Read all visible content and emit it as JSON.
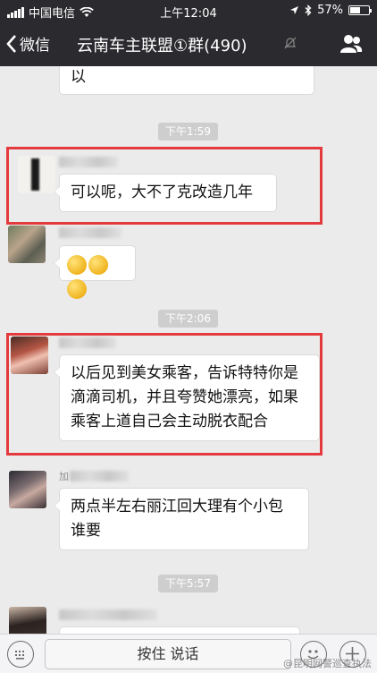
{
  "status_bar": {
    "carrier": "中国电信",
    "time": "上午12:04",
    "battery": "57%",
    "battery_level": 0.57
  },
  "nav": {
    "back_label": "微信",
    "title": "云南车主联盟①群(490)"
  },
  "messages": {
    "top_fragment": "以",
    "time_1": "下午1:59",
    "msg_1": "可以呢，大不了克改造几年",
    "time_2": "下午2:06",
    "msg_3": "以后见到美女乘客，告诉特特你是滴滴司机，并且夸赞她漂亮，如果乘客上道自己会主动脱衣配合",
    "name_4_visible": "加",
    "msg_4": "两点半左右丽江回大理有个小包谁要",
    "time_3": "下午5:57"
  },
  "input_bar": {
    "hold_to_talk": "按住 说话"
  },
  "watermark": "@昆明网警巡查执法",
  "colors": {
    "header_bg": "#2b2b2f",
    "chat_bg": "#ebebeb",
    "highlight_red": "#e53a3d"
  },
  "icons": [
    "signal-bars-icon",
    "wifi-icon",
    "location-arrow-icon",
    "bluetooth-icon",
    "battery-icon",
    "back-chevron-icon",
    "mute-icon",
    "group-members-icon",
    "keyboard-icon",
    "emoji-icon",
    "plus-icon"
  ]
}
